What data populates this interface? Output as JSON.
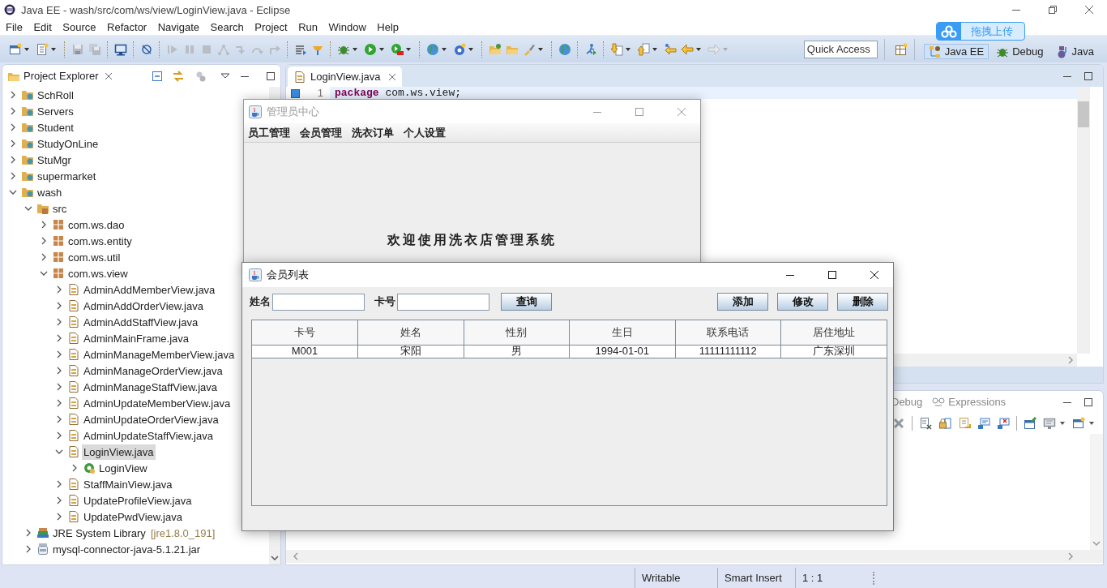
{
  "window": {
    "title": "Java EE - wash/src/com/ws/view/LoginView.java - Eclipse"
  },
  "menu": [
    "File",
    "Edit",
    "Source",
    "Refactor",
    "Navigate",
    "Search",
    "Project",
    "Run",
    "Window",
    "Help"
  ],
  "quick_access": {
    "placeholder": "Quick Access"
  },
  "perspectives": [
    {
      "label": "Java EE",
      "selected": true
    },
    {
      "label": "Debug",
      "selected": false
    },
    {
      "label": "Java",
      "selected": false
    }
  ],
  "upload_badge": {
    "label": "拖拽上传"
  },
  "project_explorer": {
    "title": "Project Explorer",
    "tree": [
      {
        "label": "SchRoll",
        "kind": "project",
        "expanded": false,
        "selected": false
      },
      {
        "label": "Servers",
        "kind": "project",
        "expanded": false,
        "selected": false
      },
      {
        "label": "Student",
        "kind": "project",
        "expanded": false,
        "selected": false
      },
      {
        "label": "StudyOnLine",
        "kind": "project",
        "expanded": false,
        "selected": false
      },
      {
        "label": "StuMgr",
        "kind": "project",
        "expanded": false,
        "selected": false
      },
      {
        "label": "supermarket",
        "kind": "project",
        "expanded": false,
        "selected": false
      },
      {
        "label": "wash",
        "kind": "project",
        "expanded": true,
        "selected": false,
        "children": [
          {
            "label": "src",
            "kind": "source-folder",
            "expanded": true,
            "selected": false,
            "children": [
              {
                "label": "com.ws.dao",
                "kind": "package",
                "expanded": false,
                "selected": false
              },
              {
                "label": "com.ws.entity",
                "kind": "package",
                "expanded": false,
                "selected": false
              },
              {
                "label": "com.ws.util",
                "kind": "package",
                "expanded": false,
                "selected": false
              },
              {
                "label": "com.ws.view",
                "kind": "package",
                "expanded": true,
                "selected": false,
                "children": [
                  {
                    "label": "AdminAddMemberView.java",
                    "kind": "java-file",
                    "expanded": false,
                    "selected": false
                  },
                  {
                    "label": "AdminAddOrderView.java",
                    "kind": "java-file",
                    "expanded": false,
                    "selected": false
                  },
                  {
                    "label": "AdminAddStaffView.java",
                    "kind": "java-file",
                    "expanded": false,
                    "selected": false
                  },
                  {
                    "label": "AdminMainFrame.java",
                    "kind": "java-file",
                    "expanded": false,
                    "selected": false
                  },
                  {
                    "label": "AdminManageMemberView.java",
                    "kind": "java-file",
                    "expanded": false,
                    "selected": false
                  },
                  {
                    "label": "AdminManageOrderView.java",
                    "kind": "java-file",
                    "expanded": false,
                    "selected": false
                  },
                  {
                    "label": "AdminManageStaffView.java",
                    "kind": "java-file",
                    "expanded": false,
                    "selected": false
                  },
                  {
                    "label": "AdminUpdateMemberView.java",
                    "kind": "java-file",
                    "expanded": false,
                    "selected": false
                  },
                  {
                    "label": "AdminUpdateOrderView.java",
                    "kind": "java-file",
                    "expanded": false,
                    "selected": false
                  },
                  {
                    "label": "AdminUpdateStaffView.java",
                    "kind": "java-file",
                    "expanded": false,
                    "selected": false
                  },
                  {
                    "label": "LoginView.java",
                    "kind": "java-file",
                    "expanded": true,
                    "selected": true,
                    "children": [
                      {
                        "label": "LoginView",
                        "kind": "class",
                        "expanded": false,
                        "selected": false
                      }
                    ]
                  },
                  {
                    "label": "StaffMainView.java",
                    "kind": "java-file",
                    "expanded": false,
                    "selected": false
                  },
                  {
                    "label": "UpdateProfileView.java",
                    "kind": "java-file",
                    "expanded": false,
                    "selected": false
                  },
                  {
                    "label": "UpdatePwdView.java",
                    "kind": "java-file",
                    "expanded": false,
                    "selected": false
                  }
                ]
              }
            ]
          },
          {
            "label": "JRE System Library",
            "decoration": "[jre1.8.0_191]",
            "kind": "library",
            "expanded": false,
            "selected": false
          },
          {
            "label": "mysql-connector-java-5.1.21.jar",
            "kind": "jar",
            "expanded": false,
            "selected": false
          }
        ]
      }
    ]
  },
  "editor": {
    "tabs": [
      {
        "label": "LoginView.java",
        "selected": true
      }
    ],
    "lines": [
      {
        "number": "1",
        "code": "**package** com.ws.view;"
      }
    ]
  },
  "bottom_panel": {
    "tabs": [
      {
        "label": "Debug"
      },
      {
        "label": "Expressions"
      }
    ]
  },
  "status_bar": [
    "Writable",
    "Smart Insert",
    "1 : 1"
  ],
  "admin_window": {
    "title": "管理员中心",
    "menu": [
      "员工管理",
      "会员管理",
      "洗衣订单",
      "个人设置"
    ],
    "welcome": "欢迎使用洗衣店管理系统"
  },
  "member_window": {
    "title": "会员列表",
    "filters": [
      {
        "label": "姓名"
      },
      {
        "label": "卡号"
      }
    ],
    "search_button": "查询",
    "buttons": [
      "添加",
      "修改",
      "删除"
    ],
    "table": {
      "columns": [
        "卡号",
        "姓名",
        "性别",
        "生日",
        "联系电话",
        "居住地址"
      ],
      "rows": [
        [
          "M001",
          "宋阳",
          "男",
          "1994-01-01",
          "11111111112",
          "广东深圳"
        ]
      ]
    }
  }
}
